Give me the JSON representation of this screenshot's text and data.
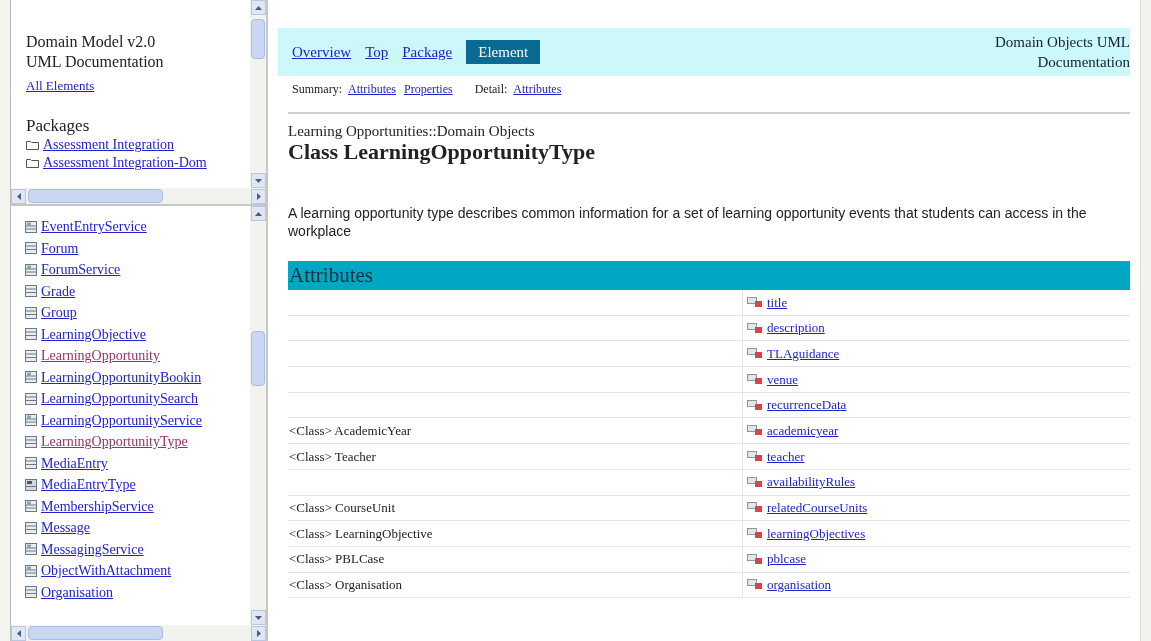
{
  "sidebar_top": {
    "title": "Domain Model v2.0 UML Documentation",
    "all_link": "All Elements",
    "packages_heading": "Packages",
    "packages": [
      "Assessment Integration",
      "Assessment Integration-Dom"
    ]
  },
  "sidebar_list": [
    {
      "label": "EventEntryService",
      "kind": "service",
      "visited": false
    },
    {
      "label": "Forum",
      "kind": "class",
      "visited": false
    },
    {
      "label": "ForumService",
      "kind": "service",
      "visited": false
    },
    {
      "label": "Grade",
      "kind": "class",
      "visited": false
    },
    {
      "label": "Group",
      "kind": "class",
      "visited": false
    },
    {
      "label": "LearningObjective",
      "kind": "class",
      "visited": false
    },
    {
      "label": "LearningOpportunity",
      "kind": "class",
      "visited": true
    },
    {
      "label": "LearningOpportunityBookin",
      "kind": "service",
      "visited": false
    },
    {
      "label": "LearningOpportunitySearch",
      "kind": "class",
      "visited": false
    },
    {
      "label": "LearningOpportunityService",
      "kind": "service",
      "visited": false
    },
    {
      "label": "LearningOpportunityType",
      "kind": "class",
      "visited": true
    },
    {
      "label": "MediaEntry",
      "kind": "class",
      "visited": false
    },
    {
      "label": "MediaEntryType",
      "kind": "enum",
      "visited": false
    },
    {
      "label": "MembershipService",
      "kind": "service",
      "visited": false
    },
    {
      "label": "Message",
      "kind": "class",
      "visited": false
    },
    {
      "label": "MessagingService",
      "kind": "service",
      "visited": false
    },
    {
      "label": "ObjectWithAttachment",
      "kind": "service",
      "visited": false
    },
    {
      "label": "Organisation",
      "kind": "class",
      "visited": false
    }
  ],
  "nav": {
    "tabs": [
      {
        "label": "Overview",
        "selected": false
      },
      {
        "label": "Top",
        "selected": false
      },
      {
        "label": "Package",
        "selected": false
      },
      {
        "label": "Element",
        "selected": true
      }
    ],
    "doc_title": "Domain Objects UML Documentation",
    "summary_label": "Summary:",
    "summary_links": [
      "Attributes",
      "Properties"
    ],
    "detail_label": "Detail:",
    "detail_links": [
      "Attributes"
    ]
  },
  "header": {
    "package_path": "Learning Opportunities::Domain Objects",
    "class_title": "Class LearningOpportunityType"
  },
  "description": "A learning opportunity type describes common information for a set of learning opportunity events that students can access in the workplace",
  "table": {
    "title": "Attributes",
    "rows": [
      {
        "type": "",
        "name": "title"
      },
      {
        "type": "",
        "name": "description"
      },
      {
        "type": "",
        "name": "TLAguidance"
      },
      {
        "type": "",
        "name": "venue"
      },
      {
        "type": "",
        "name": "recurrenceData"
      },
      {
        "type": "<Class> AcademicYear",
        "name": "academicyear"
      },
      {
        "type": "<Class> Teacher",
        "name": "teacher"
      },
      {
        "type": "",
        "name": "availabilityRules"
      },
      {
        "type": "<Class> CourseUnit",
        "name": "relatedCourseUnits"
      },
      {
        "type": "<Class> LearningObjective",
        "name": "learningObjectives"
      },
      {
        "type": "<Class> PBLCase",
        "name": "pblcase"
      },
      {
        "type": "<Class> Organisation",
        "name": "organisation"
      }
    ]
  }
}
